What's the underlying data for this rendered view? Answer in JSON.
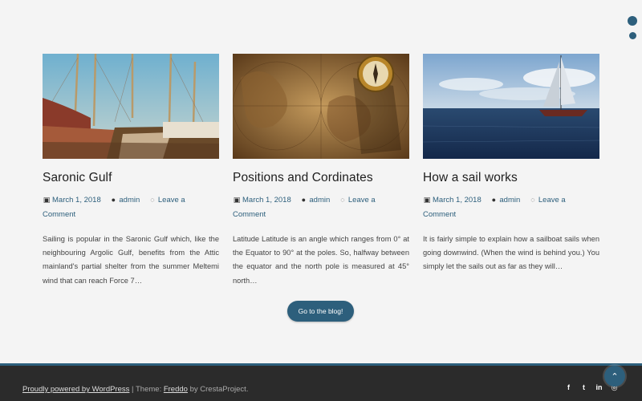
{
  "posts": [
    {
      "title": "Saronic Gulf",
      "date": "March 1, 2018",
      "author": "admin",
      "comment_label": "Leave a Comment",
      "excerpt": "Sailing is popular in the Saronic Gulf which, like the neighbouring Argolic Gulf, benefits from the Attic mainland's partial shelter from the summer Meltemi wind that can reach Force 7…"
    },
    {
      "title": "Positions and Cordinates",
      "date": "March 1, 2018",
      "author": "admin",
      "comment_label": "Leave a Comment",
      "excerpt": "Latitude Latitude is an angle which ranges from 0° at the Equator to 90° at the poles. So, halfway between the equator and the north pole is measured at 45° north…"
    },
    {
      "title": "How a sail works",
      "date": "March 1, 2018",
      "author": "admin",
      "comment_label": "Leave a Comment",
      "excerpt": "It is fairly simple to explain how a sailboat sails when going downwind. (When the wind is behind you.) You simply let the sails out as far as they will…"
    }
  ],
  "blog_button": "Go to the blog!",
  "footer": {
    "powered_link": "Proudly powered by WordPress",
    "separator": " | Theme: ",
    "theme_link": "Freddo",
    "by_text": " by CrestaProject."
  },
  "social_icons": [
    "facebook-icon",
    "twitter-icon",
    "linkedin-icon",
    "instagram-icon"
  ],
  "colors": {
    "accent": "#2d5f7c",
    "footer_bg": "#2b2b2b",
    "page_bg": "#f4f4f4"
  }
}
